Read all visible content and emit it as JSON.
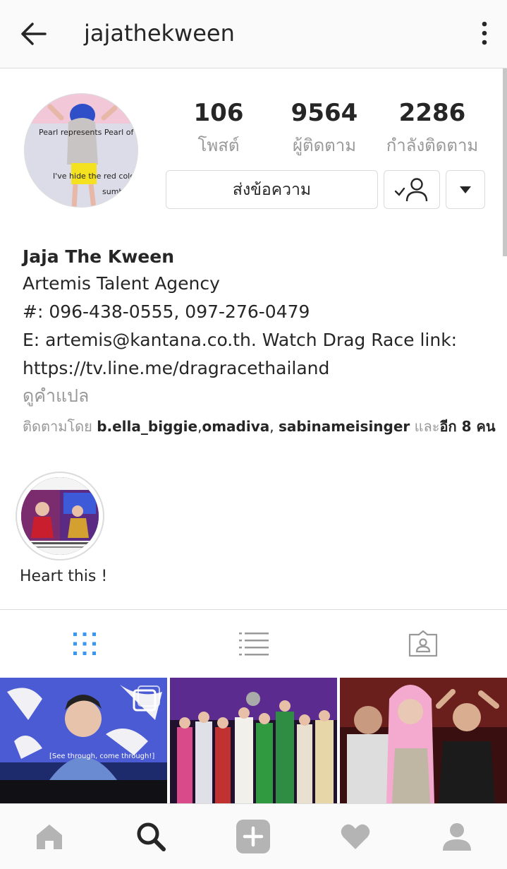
{
  "header": {
    "username": "jajathekween"
  },
  "stats": [
    {
      "value": "106",
      "label": "โพสต์"
    },
    {
      "value": "9564",
      "label": "ผู้ติดตาม"
    },
    {
      "value": "2286",
      "label": "กำลังติดตาม"
    }
  ],
  "actions": {
    "message_label": "ส่งข้อความ"
  },
  "bio": {
    "name": "Jaja The Kween",
    "lines": [
      "Artemis Talent Agency",
      "#: 096-438-0555, 097-276-0479",
      "E: artemis@kantana.co.th. Watch Drag Race link:",
      "https://tv.line.me/dragracethailand"
    ],
    "translate": "ดูคำแปล"
  },
  "followed_by": {
    "prefix": "ติดตามโดย ",
    "users": [
      "b.ella_biggie",
      "omadiva",
      "sabinameisinger"
    ],
    "suffix_connector": " และ",
    "more": "อีก 8 คน"
  },
  "highlight": {
    "label": "Heart this !"
  },
  "avatar_caption": {
    "line1": "Pearl represents Pearl of th",
    "line2": "I've hide the red colo",
    "line3": "sumb"
  },
  "posts_overlay": {
    "subtitle": "[See through, come through!]"
  },
  "colors": {
    "accent": "#3897f0",
    "text": "#262626",
    "muted": "#999999",
    "border": "#dbdbdb"
  }
}
